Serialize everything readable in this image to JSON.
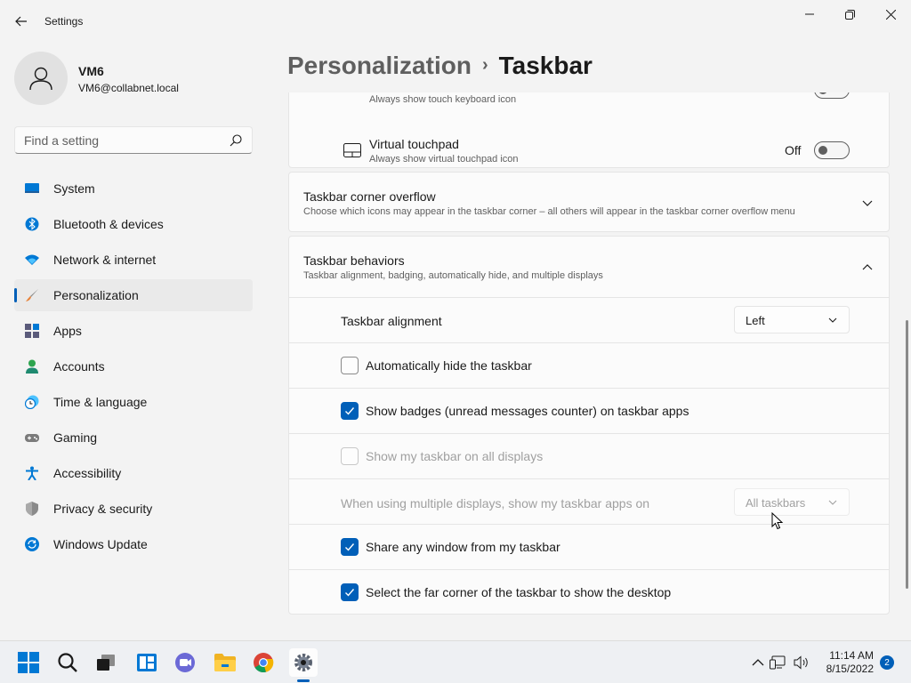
{
  "window": {
    "app_title": "Settings"
  },
  "profile": {
    "name": "VM6",
    "email": "VM6@collabnet.local"
  },
  "search": {
    "placeholder": "Find a setting"
  },
  "sidebar": {
    "items": [
      {
        "label": "System",
        "icon": "monitor-icon"
      },
      {
        "label": "Bluetooth & devices",
        "icon": "bluetooth-icon"
      },
      {
        "label": "Network & internet",
        "icon": "wifi-icon"
      },
      {
        "label": "Personalization",
        "icon": "brush-icon",
        "active": true
      },
      {
        "label": "Apps",
        "icon": "apps-icon"
      },
      {
        "label": "Accounts",
        "icon": "person-icon"
      },
      {
        "label": "Time & language",
        "icon": "clock-globe-icon"
      },
      {
        "label": "Gaming",
        "icon": "gamepad-icon"
      },
      {
        "label": "Accessibility",
        "icon": "accessibility-icon"
      },
      {
        "label": "Privacy & security",
        "icon": "shield-icon"
      },
      {
        "label": "Windows Update",
        "icon": "update-icon"
      }
    ]
  },
  "header": {
    "breadcrumb_parent": "Personalization",
    "breadcrumb_separator": "›",
    "breadcrumb_current": "Taskbar"
  },
  "corner_icons": {
    "touch_keyboard": {
      "subtitle": "Always show touch keyboard icon",
      "state": "Off"
    },
    "virtual_touchpad": {
      "title": "Virtual touchpad",
      "subtitle": "Always show virtual touchpad icon",
      "state": "Off"
    }
  },
  "corner_overflow": {
    "title": "Taskbar corner overflow",
    "subtitle": "Choose which icons may appear in the taskbar corner – all others will appear in the taskbar corner overflow menu"
  },
  "behaviors": {
    "title": "Taskbar behaviors",
    "subtitle": "Taskbar alignment, badging, automatically hide, and multiple displays",
    "alignment_label": "Taskbar alignment",
    "alignment_value": "Left",
    "auto_hide": {
      "label": "Automatically hide the taskbar",
      "checked": false
    },
    "badges": {
      "label": "Show badges (unread messages counter) on taskbar apps",
      "checked": true
    },
    "all_displays": {
      "label": "Show my taskbar on all displays",
      "checked": false,
      "disabled": true
    },
    "multi_display_label": "When using multiple displays, show my taskbar apps on",
    "multi_display_value": "All taskbars",
    "share_window": {
      "label": "Share any window from my taskbar",
      "checked": true
    },
    "far_corner": {
      "label": "Select the far corner of the taskbar to show the desktop",
      "checked": true
    }
  },
  "taskbar": {
    "time": "11:14 AM",
    "date": "8/15/2022",
    "notification_count": "2"
  },
  "colors": {
    "accent": "#005fb8",
    "background": "#f3f3f3",
    "card": "#fbfbfb"
  }
}
